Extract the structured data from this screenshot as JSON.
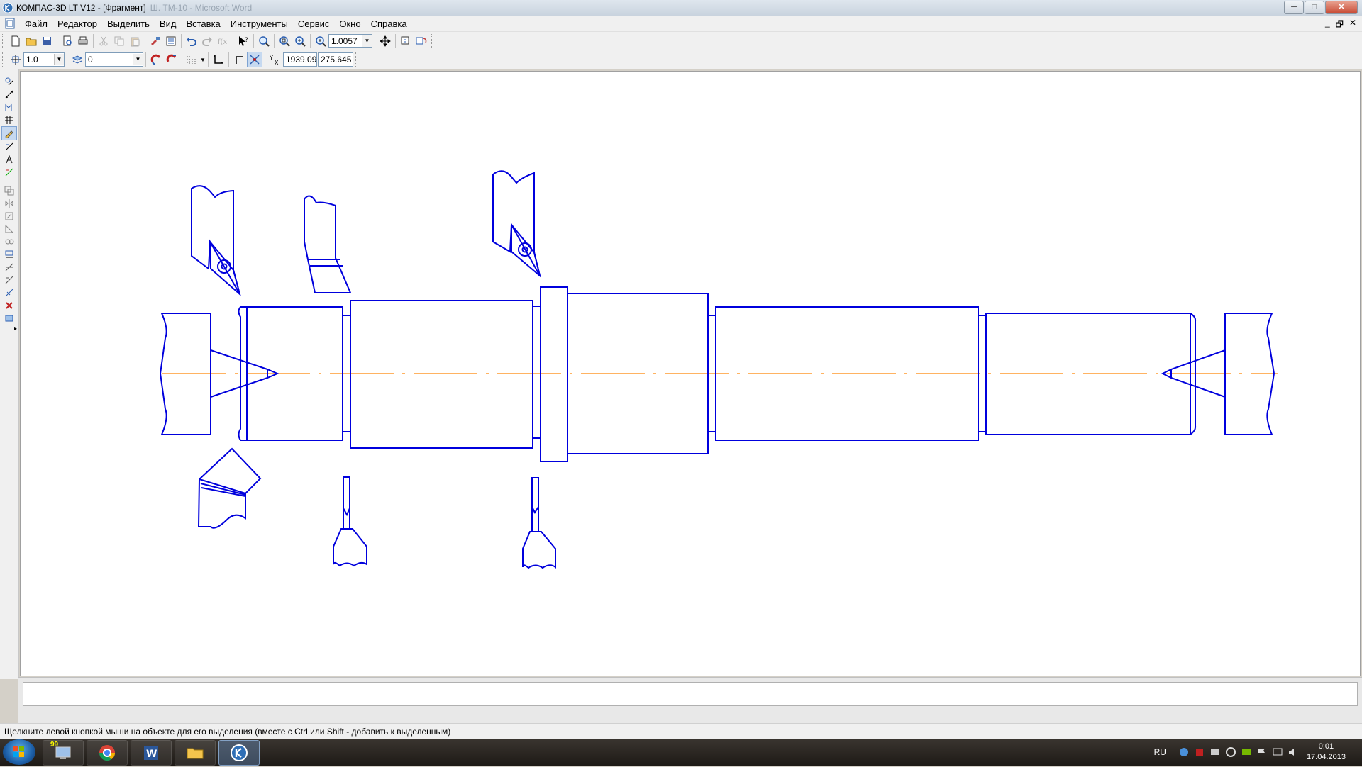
{
  "window": {
    "title": "КОМПАС-3D LT V12 - [Фрагмент]",
    "ghost_title": "Ш. ТМ-10 - Microsoft Word",
    "minimize": "─",
    "maximize": "□",
    "close": "✕"
  },
  "menu": {
    "items": [
      "Файл",
      "Редактор",
      "Выделить",
      "Вид",
      "Вставка",
      "Инструменты",
      "Сервис",
      "Окно",
      "Справка"
    ],
    "mdi_min": "_",
    "mdi_restore": "🗗",
    "mdi_close": "✕"
  },
  "toolbar1": {
    "zoom_value": "1.0057"
  },
  "toolbar2": {
    "step_value": "1.0",
    "layer_value": "0",
    "coord_x": "1939.09",
    "coord_y": "275.645"
  },
  "status": {
    "hint": "Щелкните левой кнопкой мыши на объекте для его выделения (вместе с Ctrl или Shift - добавить к выделенным)"
  },
  "taskbar": {
    "apps": [
      "windows-explorer",
      "chrome",
      "word",
      "file-manager",
      "kompas"
    ],
    "badge": "99",
    "lang": "RU",
    "time": "0:01",
    "date": "17.04.2013"
  },
  "colors": {
    "drawing": "#0000dd",
    "axis": "#ff9a2e",
    "canvas": "#ffffff"
  }
}
